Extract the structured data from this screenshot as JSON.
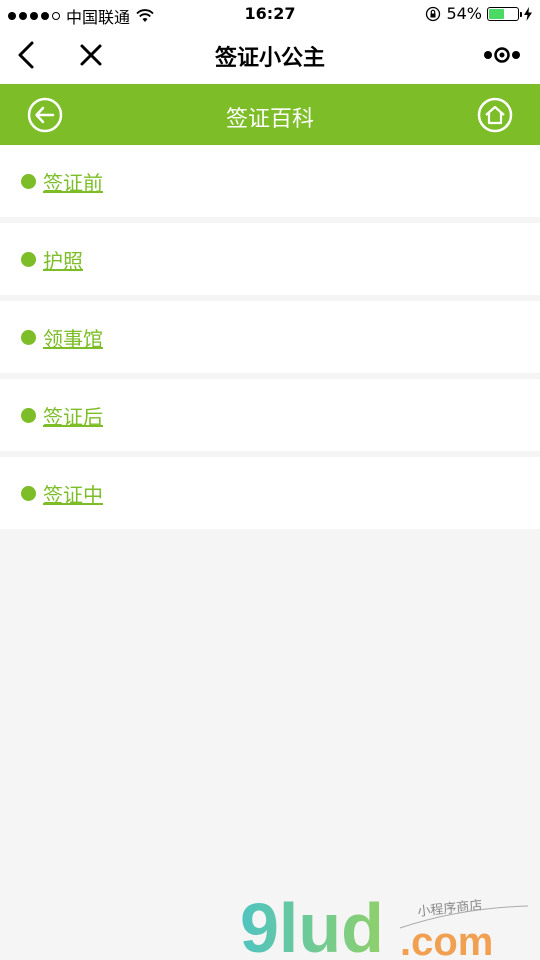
{
  "status_bar": {
    "carrier": "中国联通",
    "time": "16:27",
    "battery_percent": "54%",
    "battery_level": 0.54
  },
  "nav": {
    "title": "签证小公主"
  },
  "header": {
    "title": "签证百科"
  },
  "list": {
    "items": [
      {
        "label": "签证前"
      },
      {
        "label": "护照"
      },
      {
        "label": "领事馆"
      },
      {
        "label": "签证后"
      },
      {
        "label": "签证中"
      }
    ]
  },
  "watermark": {
    "brand": "9lud",
    "tld": ".com",
    "tagline": "小程序商店"
  },
  "colors": {
    "accent": "#7cbd28",
    "background": "#f5f5f5",
    "battery": "#4cd964"
  },
  "icons": {
    "back": "chevron-left-icon",
    "close": "close-icon",
    "more": "more-dots-icon",
    "header_back": "circle-arrow-left-icon",
    "home": "home-circle-icon"
  }
}
